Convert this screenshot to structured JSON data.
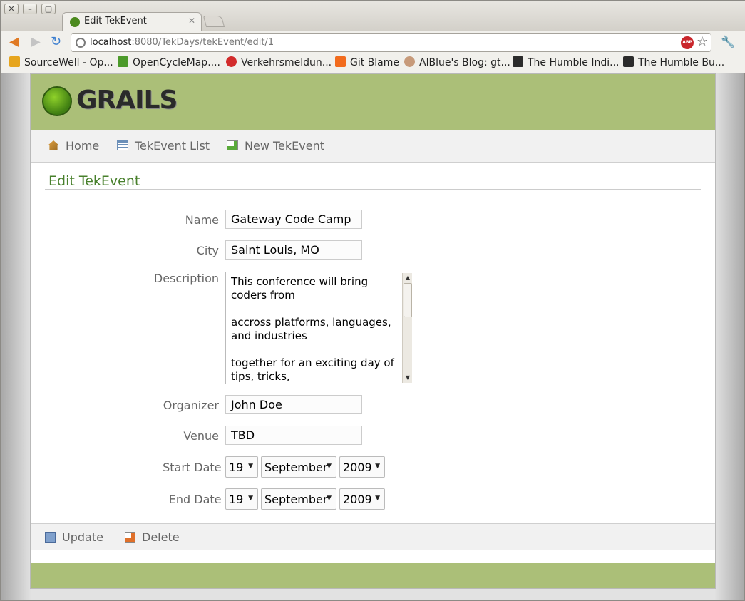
{
  "browser": {
    "tab_title": "Edit TekEvent",
    "url_host": "localhost",
    "url_rest": ":8080/TekDays/tekEvent/edit/1",
    "bookmarks": [
      {
        "label": "SourceWell - Op...",
        "color": "#e6a51e"
      },
      {
        "label": "OpenCycleMap....",
        "color": "#4c9a2a"
      },
      {
        "label": "Verkehrsmeldun...",
        "color": "#d22b2b"
      },
      {
        "label": "Git Blame",
        "color": "#f26b1d"
      },
      {
        "label": "AlBlue's Blog: gt...",
        "color": "#c79a7a"
      },
      {
        "label": "The Humble Indi...",
        "color": "#2b2b2b"
      },
      {
        "label": "The Humble Bu...",
        "color": "#2b2b2b"
      }
    ]
  },
  "app": {
    "logo": "GRAILS",
    "nav": {
      "home": "Home",
      "list": "TekEvent List",
      "new": "New TekEvent"
    },
    "heading": "Edit TekEvent"
  },
  "form": {
    "labels": {
      "name": "Name",
      "city": "City",
      "description": "Description",
      "organizer": "Organizer",
      "venue": "Venue",
      "start_date": "Start Date",
      "end_date": "End Date",
      "required_mark": "*"
    },
    "values": {
      "name": "Gateway Code Camp",
      "city": "Saint Louis, MO",
      "description": "This conference will bring coders from\n\naccross platforms, languages, and industries\n\ntogether for an exciting day of tips, tricks,",
      "organizer": "John Doe",
      "venue": "TBD",
      "start_day": "19",
      "start_month": "September",
      "start_year": "2009",
      "end_day": "19",
      "end_month": "September",
      "end_year": "2009"
    }
  },
  "buttons": {
    "update": "Update",
    "delete": "Delete"
  },
  "colors": {
    "green": "#abbf78",
    "heading": "#48802c"
  }
}
